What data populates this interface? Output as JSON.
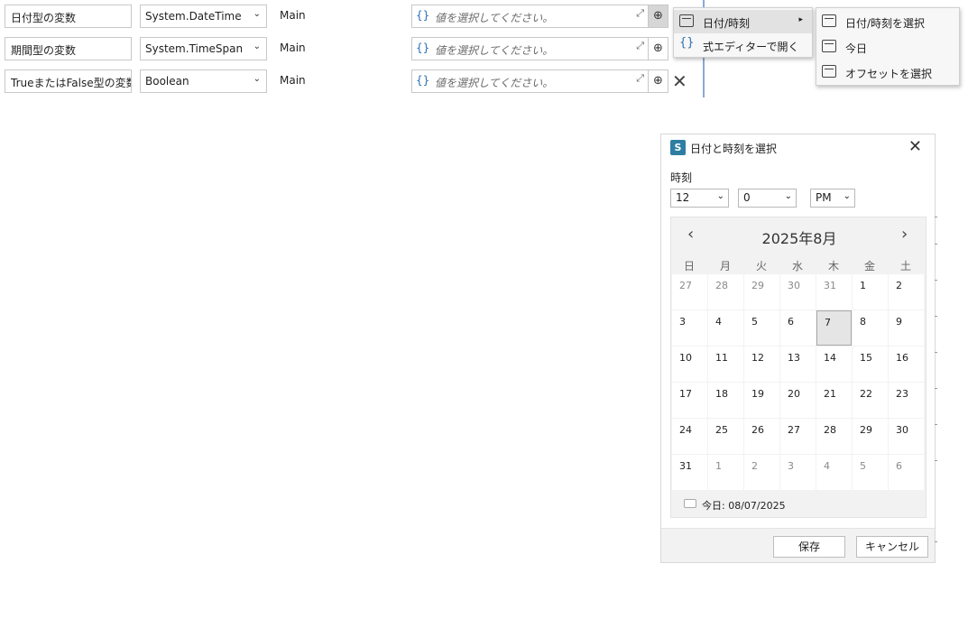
{
  "rows": [
    {
      "name": "日付型の変数",
      "type": "System.DateTime",
      "scope": "Main",
      "placeholder": "値を選択してください。"
    },
    {
      "name": "期間型の変数",
      "type": "System.TimeSpan",
      "scope": "Main",
      "placeholder": "値を選択してください。"
    },
    {
      "name": "TrueまたはFalse型の変数",
      "type": "Boolean",
      "scope": "Main",
      "placeholder": "値を選択してください。"
    }
  ],
  "icons": {
    "expression": "{}",
    "expand": "⤢",
    "add": "⊕",
    "delete": "✕",
    "chevron": "⌄",
    "submenu_arrow": "▸"
  },
  "context_menu": {
    "items": [
      {
        "label": "日付/時刻",
        "icon": "calendar-icon",
        "has_submenu": true
      },
      {
        "label": "式エディターで開く",
        "icon": "braces-icon"
      }
    ]
  },
  "submenu": {
    "items": [
      {
        "label": "日付/時刻を選択",
        "icon": "calendar-icon"
      },
      {
        "label": "今日",
        "icon": "calendar-icon"
      },
      {
        "label": "オフセットを選択",
        "icon": "calendar-icon"
      }
    ]
  },
  "dialog": {
    "title": "日付と時刻を選択",
    "logo": "S",
    "close": "✕",
    "time_label": "時刻",
    "hour": "12",
    "minute": "0",
    "ampm": "PM",
    "calendar": {
      "month_title": "2025年8月",
      "prev": "‹",
      "next": "›",
      "weekdays": [
        "日",
        "月",
        "火",
        "水",
        "木",
        "金",
        "土"
      ],
      "days": [
        [
          "27",
          "28",
          "29",
          "30",
          "31",
          "1",
          "2"
        ],
        [
          "3",
          "4",
          "5",
          "6",
          "7",
          "8",
          "9"
        ],
        [
          "10",
          "11",
          "12",
          "13",
          "14",
          "15",
          "16"
        ],
        [
          "17",
          "18",
          "19",
          "20",
          "21",
          "22",
          "23"
        ],
        [
          "24",
          "25",
          "26",
          "27",
          "28",
          "29",
          "30"
        ],
        [
          "31",
          "1",
          "2",
          "3",
          "4",
          "5",
          "6"
        ]
      ],
      "selected_day": "7",
      "today_label": "今日: 08/07/2025"
    },
    "save_label": "保存",
    "cancel_label": "キャンセル"
  }
}
